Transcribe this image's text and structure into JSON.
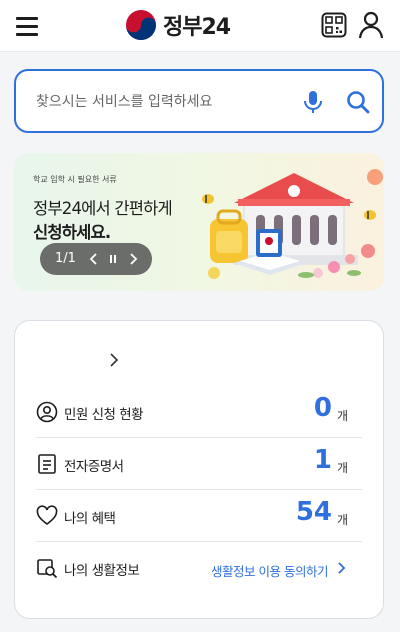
{
  "header": {
    "logo_text": "정부24",
    "icons": {
      "menu": "hamburger-icon",
      "qr": "qr-code-icon",
      "user": "user-icon",
      "logo": "taegeuk-logo-icon"
    }
  },
  "search": {
    "placeholder": "찾으시는 서비스를 입력하세요",
    "value": "",
    "icons": {
      "mic": "microphone-icon",
      "search": "search-icon"
    }
  },
  "banner": {
    "small_text": "학교 입학 시 필요한 서류",
    "title_line1": "정부24에서 간편하게",
    "title_line2": "신청하세요.",
    "pager": "1/1",
    "icons": {
      "prev": "chevron-left-icon",
      "pause": "pause-icon",
      "next": "chevron-right-icon"
    }
  },
  "summary_card": {
    "rows": [
      {
        "label": "민원 신청 현황",
        "value": "0",
        "unit": "개",
        "icon": "user-circle-icon"
      },
      {
        "label": "전자증명서",
        "value": "1",
        "unit": "개",
        "icon": "document-icon"
      },
      {
        "label": "나의 혜택",
        "value": "54",
        "unit": "개",
        "icon": "heart-icon"
      },
      {
        "label": "나의 생활정보",
        "link": "생활정보 이용 동의하기",
        "icon": "search-document-icon"
      }
    ]
  },
  "colors": {
    "accent": "#2f6fde",
    "text": "#1d1d1d",
    "background": "#f4f5f7"
  }
}
